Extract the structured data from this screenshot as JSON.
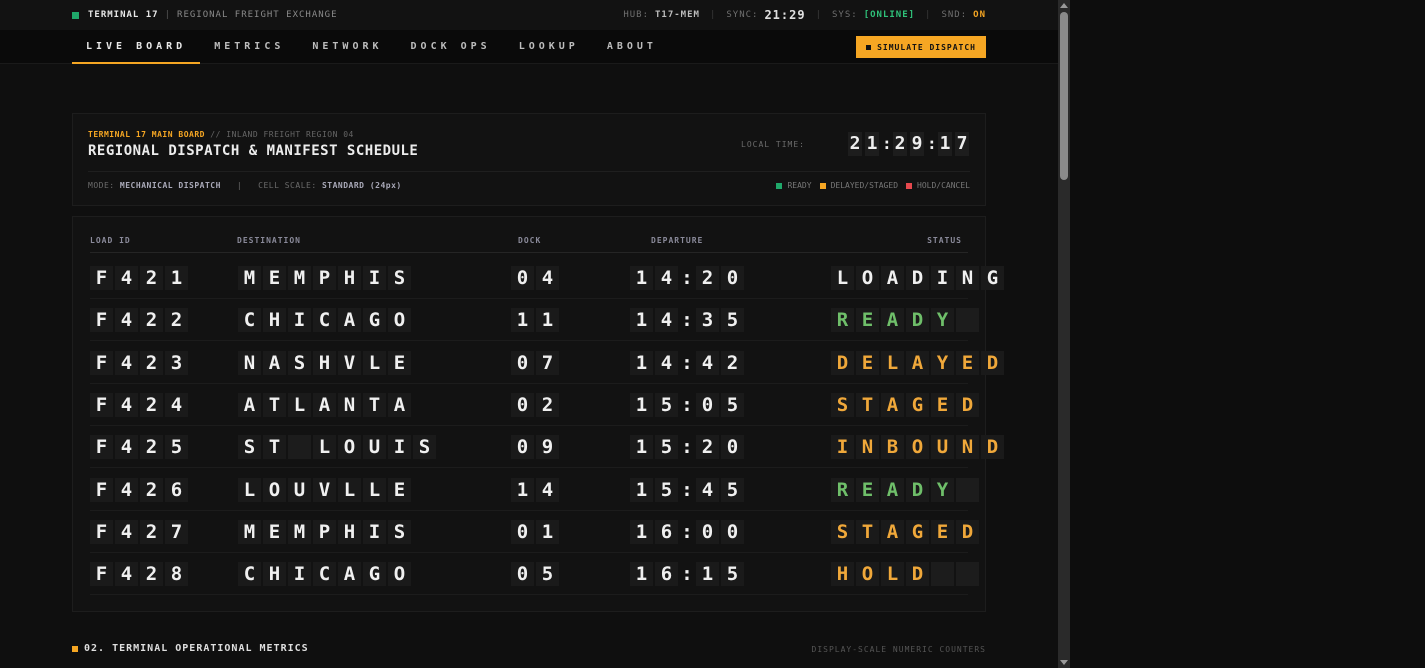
{
  "topbar": {
    "brand": "TERMINAL 17",
    "subtitle": "REGIONAL FREIGHT EXCHANGE",
    "hub_label": "HUB:",
    "hub_value": "T17-MEM",
    "sync_label": "SYNC:",
    "sync_value": "21:29",
    "sys_label": "SYS:",
    "sys_value": "[ONLINE]",
    "snd_label": "SND:",
    "snd_value": "ON"
  },
  "nav": {
    "items": [
      "LIVE BOARD",
      "METRICS",
      "NETWORK",
      "DOCK OPS",
      "LOOKUP",
      "ABOUT"
    ],
    "active": 0,
    "action_label": "SIMULATE DISPATCH"
  },
  "board_header": {
    "board_name": "TERMINAL 17 MAIN BOARD",
    "divider": "//",
    "region": "INLAND FREIGHT REGION 04",
    "title": "REGIONAL DISPATCH & MANIFEST SCHEDULE",
    "local_time_label": "LOCAL TIME:",
    "local_time": "21:29:17",
    "mode_label": "MODE:",
    "mode_value": "MECHANICAL DISPATCH",
    "scale_label": "CELL SCALE:",
    "scale_value": "STANDARD (24px)",
    "legend": [
      {
        "label": "READY",
        "color": "#1fa86a"
      },
      {
        "label": "DELAYED/STAGED",
        "color": "#f5a623"
      },
      {
        "label": "HOLD/CANCEL",
        "color": "#e5484d"
      }
    ]
  },
  "table": {
    "columns": [
      "LOAD ID",
      "DESTINATION",
      "DOCK",
      "DEPARTURE",
      "STATUS"
    ],
    "rows": [
      {
        "load_id": "F421",
        "destination": "MEMPHIS",
        "dock": "04",
        "departure": "14:20",
        "status": "LOADING",
        "tone": "white"
      },
      {
        "load_id": "F422",
        "destination": "CHICAGO",
        "dock": "11",
        "departure": "14:35",
        "status": "READY",
        "tone": "green"
      },
      {
        "load_id": "F423",
        "destination": "NASHVLE",
        "dock": "07",
        "departure": "14:42",
        "status": "DELAYED",
        "tone": "amber"
      },
      {
        "load_id": "F424",
        "destination": "ATLANTA",
        "dock": "02",
        "departure": "15:05",
        "status": "STAGED",
        "tone": "amber"
      },
      {
        "load_id": "F425",
        "destination": "ST LOUIS",
        "dock": "09",
        "departure": "15:20",
        "status": "INBOUND",
        "tone": "amber"
      },
      {
        "load_id": "F426",
        "destination": "LOUVLLE",
        "dock": "14",
        "departure": "15:45",
        "status": "READY",
        "tone": "green"
      },
      {
        "load_id": "F427",
        "destination": "MEMPHIS",
        "dock": "01",
        "departure": "16:00",
        "status": "STAGED",
        "tone": "amber"
      },
      {
        "load_id": "F428",
        "destination": "CHICAGO",
        "dock": "05",
        "departure": "16:15",
        "status": "HOLD",
        "tone": "amber"
      }
    ]
  },
  "next_section": {
    "title": "02. TERMINAL OPERATIONAL METRICS",
    "right_note": "DISPLAY-SCALE NUMERIC COUNTERS"
  }
}
